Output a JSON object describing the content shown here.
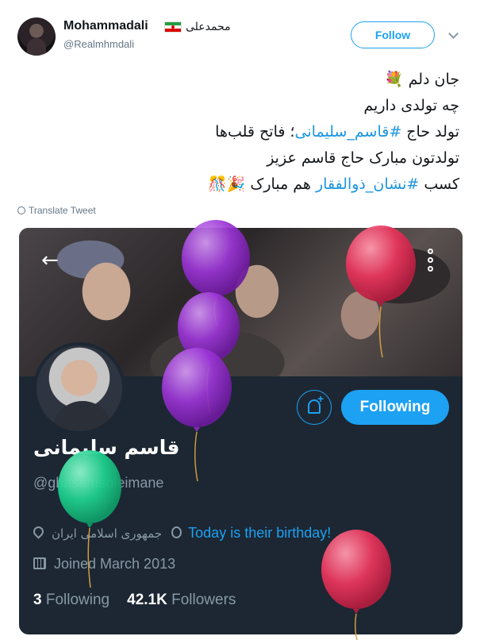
{
  "tweet": {
    "author_name": "Mohammadali",
    "author_name_fa": "محمدعلی",
    "handle": "@Realmhmdali",
    "follow_label": "Follow",
    "lines": [
      {
        "text": "جان دلم",
        "emoji": "💐"
      },
      {
        "text": "چه تولدی داریم"
      },
      {
        "pre": "تولد حاج ",
        "hashtag": "#قاسم_سلیمانی",
        "post": "؛ فاتح قلب‌ها"
      },
      {
        "text": "تولدتون مبارک حاج قاسم عزیز"
      },
      {
        "pre": "کسب ",
        "hashtag": "#نشان_ذوالفقار",
        "post": " هم مبارک ",
        "emoji": "🎉🎊"
      }
    ],
    "translate_label": "Translate Tweet"
  },
  "profile": {
    "name": "قاسم سلیمانی",
    "handle": "@ghasemsoleimane",
    "following_label": "Following",
    "location": "جمهوری اسلامی ایران",
    "birthday_text": "Today is their birthday!",
    "joined": "Joined March 2013",
    "following_count": "3",
    "following_word": "Following",
    "followers_count": "42.1K",
    "followers_word": "Followers"
  },
  "icons": [
    "avatar",
    "flag-iran-icon",
    "chevron-down-icon",
    "globe-icon",
    "back-arrow-icon",
    "more-vertical-icon",
    "bell-plus-icon",
    "location-pin-icon",
    "balloon-icon",
    "calendar-icon"
  ],
  "colors": {
    "accent": "#1da1f2",
    "hashtag": "#1b95e0",
    "card_bg": "#1c2733",
    "muted": "#8899a6",
    "balloon_purple": "#9b35d6",
    "balloon_red": "#e8365d",
    "balloon_green": "#1fcf8f"
  }
}
